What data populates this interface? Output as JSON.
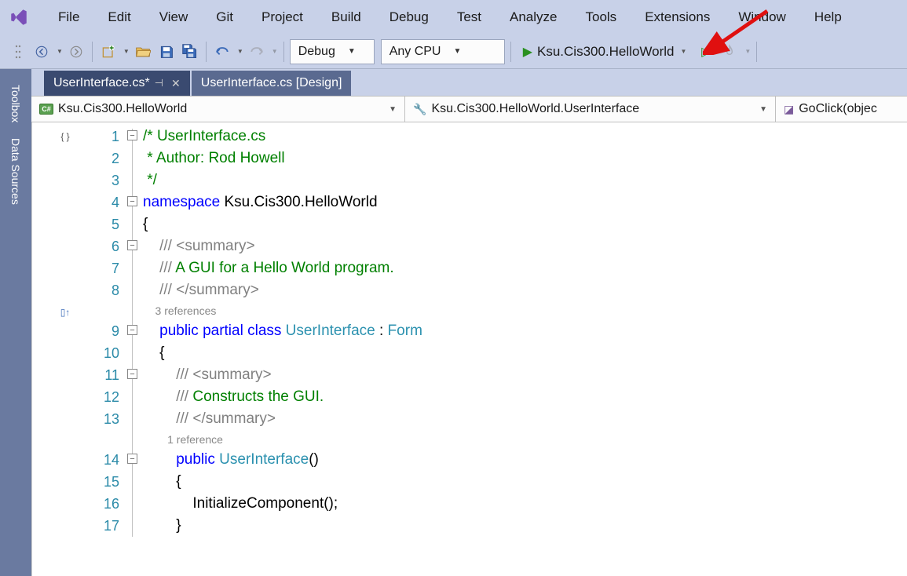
{
  "menu": {
    "items": [
      "File",
      "Edit",
      "View",
      "Git",
      "Project",
      "Build",
      "Debug",
      "Test",
      "Analyze",
      "Tools",
      "Extensions",
      "Window",
      "Help"
    ]
  },
  "toolbar": {
    "config_combo": "Debug",
    "platform_combo": "Any CPU",
    "run_target": "Ksu.Cis300.HelloWorld"
  },
  "side_tabs": [
    "Toolbox",
    "Data Sources"
  ],
  "tabs": [
    {
      "label": "UserInterface.cs*",
      "active": true
    },
    {
      "label": "UserInterface.cs [Design]",
      "active": false
    }
  ],
  "navbar": {
    "scope": "Ksu.Cis300.HelloWorld",
    "class": "Ksu.Cis300.HelloWorld.UserInterface",
    "member": "GoClick(objec"
  },
  "code": {
    "lines": [
      {
        "n": 1,
        "tokens": [
          [
            "c-comment",
            "/* UserInterface.cs"
          ]
        ]
      },
      {
        "n": 2,
        "tokens": [
          [
            "c-comment",
            " * Author: Rod Howell"
          ]
        ]
      },
      {
        "n": 3,
        "tokens": [
          [
            "c-comment",
            " */"
          ]
        ]
      },
      {
        "n": 4,
        "tokens": [
          [
            "c-keyword",
            "namespace"
          ],
          [
            "",
            " Ksu.Cis300.HelloWorld"
          ]
        ]
      },
      {
        "n": 5,
        "tokens": [
          [
            "",
            "{"
          ]
        ]
      },
      {
        "n": 6,
        "tokens": [
          [
            "",
            "    "
          ],
          [
            "c-xml",
            "/// <summary>"
          ]
        ]
      },
      {
        "n": 7,
        "tokens": [
          [
            "",
            "    "
          ],
          [
            "c-xml",
            "/// "
          ],
          [
            "c-comment",
            "A GUI for a Hello World program."
          ]
        ]
      },
      {
        "n": 8,
        "tokens": [
          [
            "",
            "    "
          ],
          [
            "c-xml",
            "/// </summary>"
          ]
        ]
      },
      {
        "ref": "    3 references"
      },
      {
        "n": 9,
        "tokens": [
          [
            "",
            "    "
          ],
          [
            "c-keyword",
            "public"
          ],
          [
            "",
            " "
          ],
          [
            "c-keyword",
            "partial"
          ],
          [
            "",
            " "
          ],
          [
            "c-keyword",
            "class"
          ],
          [
            "",
            " "
          ],
          [
            "c-type",
            "UserInterface"
          ],
          [
            "",
            " : "
          ],
          [
            "c-type",
            "Form"
          ]
        ]
      },
      {
        "n": 10,
        "tokens": [
          [
            "",
            "    {"
          ]
        ]
      },
      {
        "n": 11,
        "tokens": [
          [
            "",
            "        "
          ],
          [
            "c-xml",
            "/// <summary>"
          ]
        ]
      },
      {
        "n": 12,
        "tokens": [
          [
            "",
            "        "
          ],
          [
            "c-xml",
            "/// "
          ],
          [
            "c-comment",
            "Constructs the GUI."
          ]
        ]
      },
      {
        "n": 13,
        "tokens": [
          [
            "",
            "        "
          ],
          [
            "c-xml",
            "/// </summary>"
          ]
        ]
      },
      {
        "ref": "        1 reference"
      },
      {
        "n": 14,
        "tokens": [
          [
            "",
            "        "
          ],
          [
            "c-keyword",
            "public"
          ],
          [
            "",
            " "
          ],
          [
            "c-type",
            "UserInterface"
          ],
          [
            "",
            "()"
          ]
        ]
      },
      {
        "n": 15,
        "tokens": [
          [
            "",
            "        {"
          ]
        ]
      },
      {
        "n": 16,
        "tokens": [
          [
            "",
            "            InitializeComponent();"
          ]
        ]
      },
      {
        "n": 17,
        "tokens": [
          [
            "",
            "        }"
          ]
        ]
      }
    ]
  }
}
